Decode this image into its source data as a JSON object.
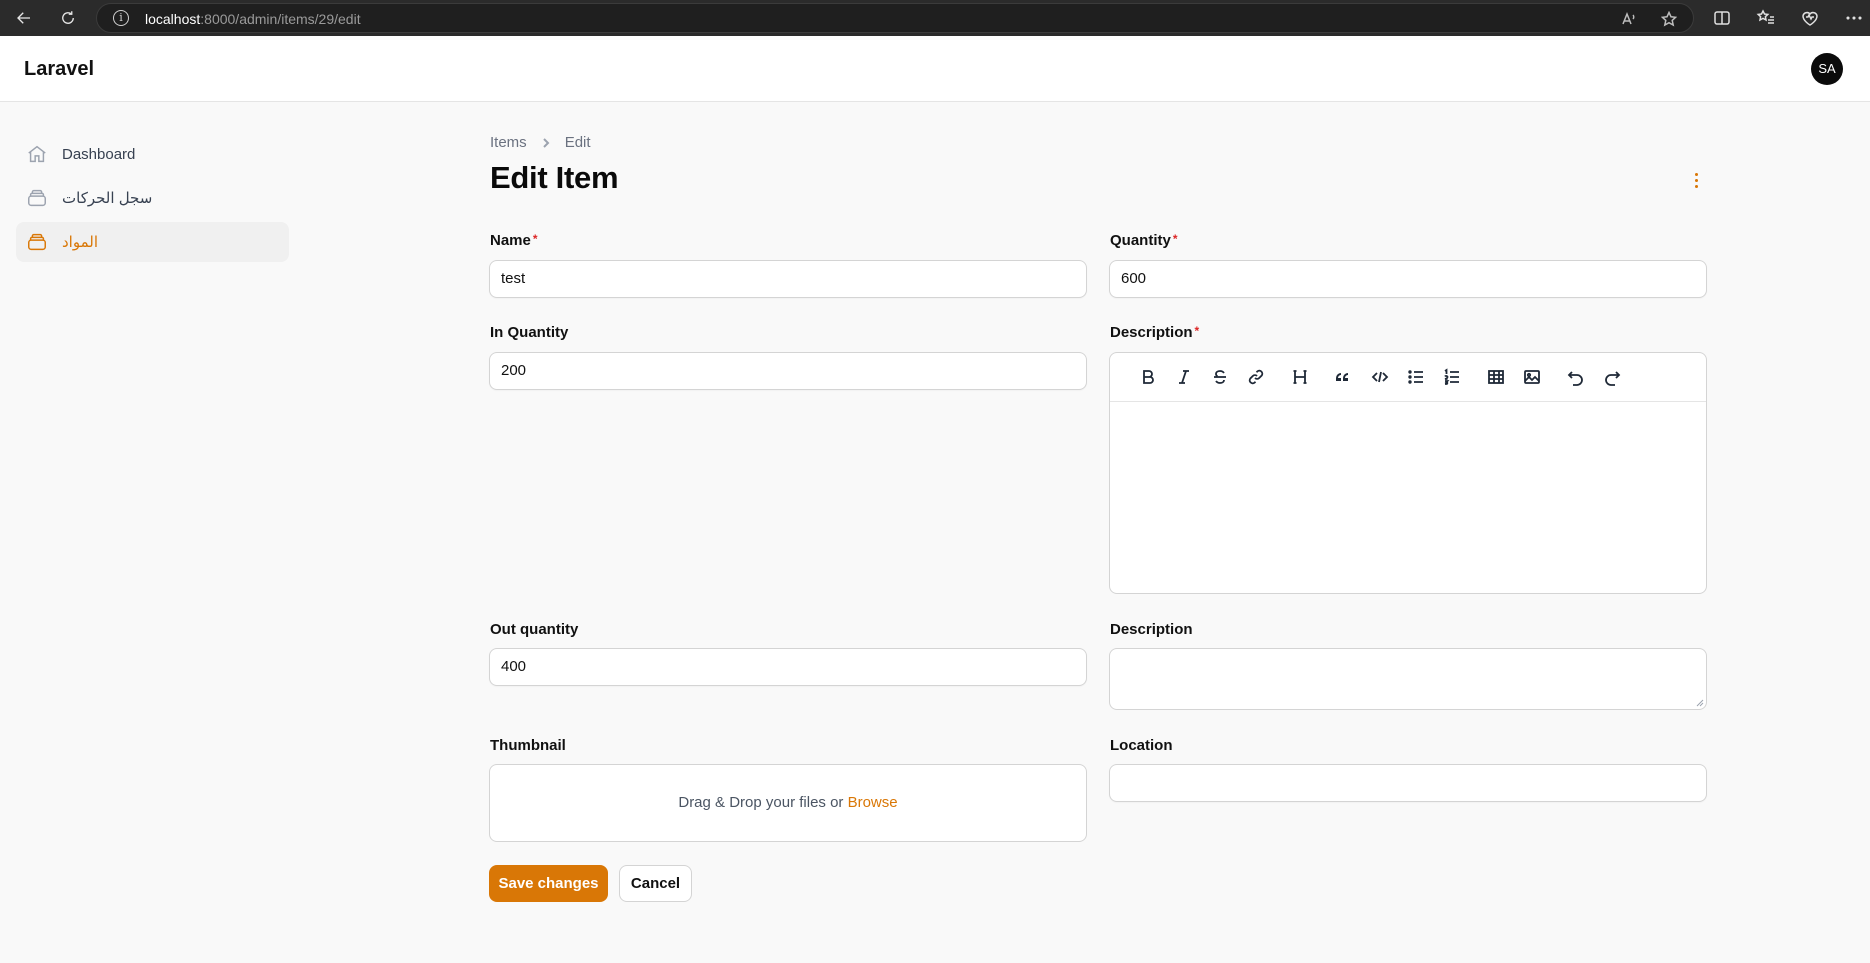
{
  "browser": {
    "url_host": "localhost",
    "url_rest": ":8000/admin/items/29/edit"
  },
  "header": {
    "brand": "Laravel",
    "avatar_initials": "SA"
  },
  "sidebar": {
    "items": [
      {
        "label": "Dashboard",
        "icon": "home-icon",
        "active": false
      },
      {
        "label": "سجل الحركات",
        "icon": "stack-icon",
        "active": false
      },
      {
        "label": "المواد",
        "icon": "stack-icon",
        "active": true
      }
    ]
  },
  "breadcrumb": {
    "parent": "Items",
    "current": "Edit"
  },
  "page": {
    "title": "Edit Item"
  },
  "form": {
    "name": {
      "label": "Name",
      "required_mark": "*",
      "value": "test"
    },
    "quantity": {
      "label": "Quantity",
      "required_mark": "*",
      "value": "600"
    },
    "in_quantity": {
      "label": "In Quantity",
      "value": "200"
    },
    "description_rich": {
      "label": "Description",
      "required_mark": "*",
      "value": ""
    },
    "out_quantity": {
      "label": "Out quantity",
      "value": "400"
    },
    "description": {
      "label": "Description",
      "value": ""
    },
    "thumbnail": {
      "label": "Thumbnail",
      "drop_text": "Drag & Drop your files or ",
      "browse_text": "Browse"
    },
    "location": {
      "label": "Location",
      "value": ""
    }
  },
  "toolbar": [
    "bold",
    "italic",
    "strike",
    "link",
    "heading",
    "blockquote",
    "code-block",
    "bullet-list",
    "ordered-list",
    "table",
    "attach-image",
    "undo",
    "redo"
  ],
  "actions": {
    "save_label": "Save changes",
    "cancel_label": "Cancel"
  },
  "colors": {
    "primary": "#d97706",
    "required": "#dc2626"
  }
}
